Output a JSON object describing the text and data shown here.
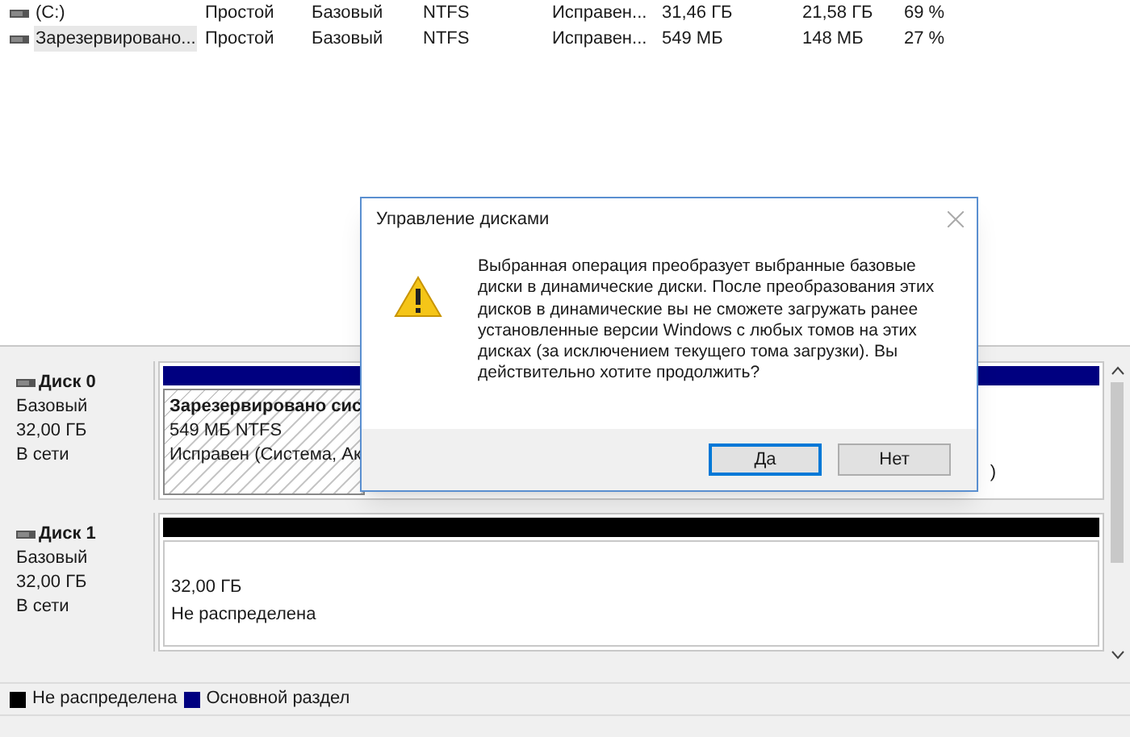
{
  "volumes": [
    {
      "name": "(C:)",
      "selected": false,
      "cells": [
        "Простой",
        "Базовый",
        "NTFS",
        "Исправен...",
        "31,46 ГБ",
        "21,58 ГБ",
        "69 %"
      ]
    },
    {
      "name": "Зарезервировано...",
      "selected": true,
      "cells": [
        "Простой",
        "Базовый",
        "NTFS",
        "Исправен...",
        "549 МБ",
        "148 МБ",
        "27 %"
      ]
    }
  ],
  "disks": [
    {
      "name": "Диск 0",
      "lines": [
        "Базовый",
        "32,00 ГБ",
        "В сети"
      ],
      "color": "#000080",
      "partition": {
        "kind": "hatched",
        "title": "Зарезервировано сис",
        "lines": [
          "549 МБ NTFS",
          "Исправен (Система, Ак"
        ],
        "tail": ")"
      }
    },
    {
      "name": "Диск 1",
      "lines": [
        "Базовый",
        "32,00 ГБ",
        "В сети"
      ],
      "color": "#000000",
      "partition": {
        "kind": "plain",
        "lines": [
          "32,00 ГБ",
          "Не распределена"
        ]
      }
    }
  ],
  "legend": [
    {
      "label": "Не распределена",
      "color": "#000000"
    },
    {
      "label": "Основной раздел",
      "color": "#000080"
    }
  ],
  "dialog": {
    "title": "Управление дисками",
    "message": "Выбранная операция преобразует выбранные базовые диски в динамические диски. После преобразования этих дисков в динамические вы не сможете загружать ранее установленные версии Windows с любых томов на этих дисках (за исключением текущего тома загрузки). Вы действительно хотите продолжить?",
    "buttons": [
      {
        "label": "Да",
        "default": true
      },
      {
        "label": "Нет",
        "default": false
      }
    ]
  }
}
